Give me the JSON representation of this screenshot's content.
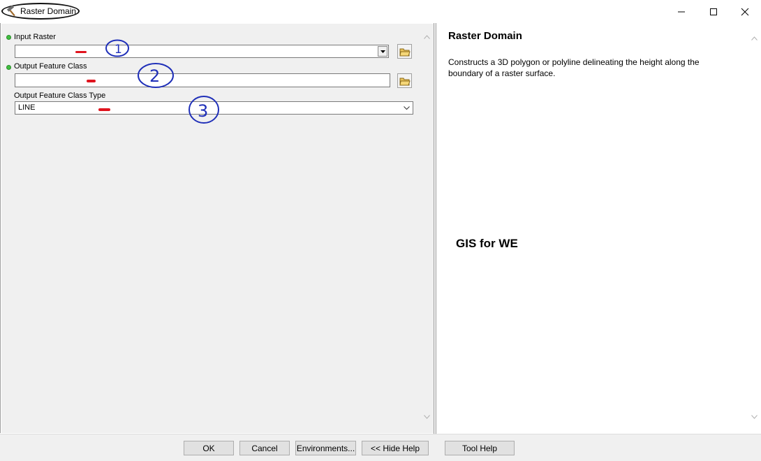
{
  "window": {
    "title": "Raster Domain"
  },
  "params": {
    "input_raster_label": "Input Raster",
    "input_raster_value": "",
    "output_feature_class_label": "Output Feature Class",
    "output_feature_class_value": "",
    "output_type_label": "Output Feature Class Type",
    "output_type_value": "LINE"
  },
  "help": {
    "title": "Raster Domain",
    "description": "Constructs a 3D polygon or polyline delineating the height along the boundary of a raster surface."
  },
  "watermark": "GIS for WE",
  "buttons": {
    "ok": "OK",
    "cancel": "Cancel",
    "environments": "Environments...",
    "hide_help": "<< Hide Help",
    "tool_help": "Tool Help"
  },
  "annotations": {
    "n1": "1",
    "n2": "2",
    "n3": "3"
  },
  "colors": {
    "required_dot": "#3fbf3f",
    "annotation_ink": "#1f2fb8",
    "mark_red": "#e0141e"
  }
}
